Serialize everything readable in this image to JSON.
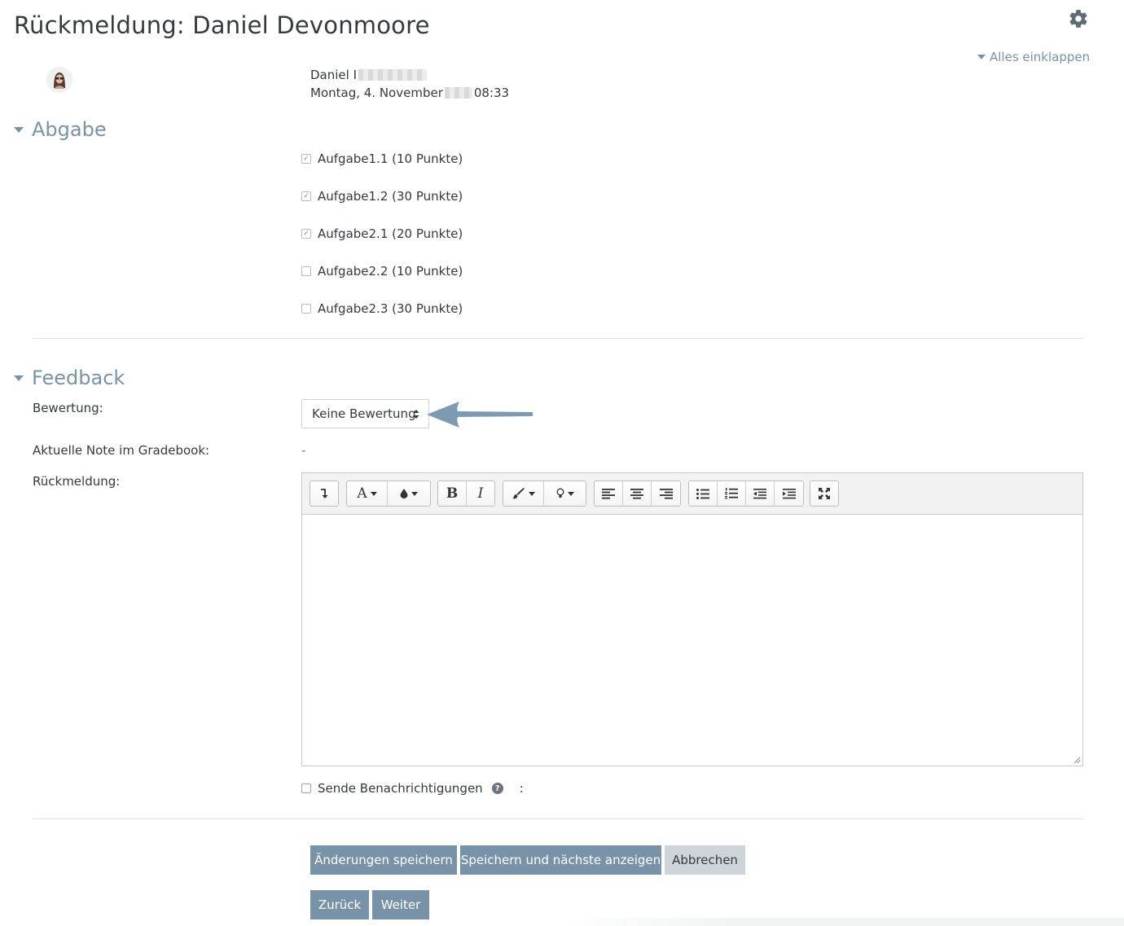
{
  "header": {
    "title": "Rückmeldung: Daniel Devonmoore",
    "collapse_all": "Alles einklappen"
  },
  "user": {
    "name_visible": "Daniel I",
    "date_before": "Montag, 4. November",
    "date_after": " 08:33"
  },
  "submission": {
    "heading": "Abgabe",
    "items": [
      {
        "label": "Aufgabe1.1 (10 Punkte)",
        "checked": true
      },
      {
        "label": "Aufgabe1.2 (30 Punkte)",
        "checked": true
      },
      {
        "label": "Aufgabe2.1 (20 Punkte)",
        "checked": true
      },
      {
        "label": "Aufgabe2.2 (10 Punkte)",
        "checked": false
      },
      {
        "label": "Aufgabe2.3 (30 Punkte)",
        "checked": false
      }
    ]
  },
  "feedback": {
    "heading": "Feedback",
    "grade_label": "Bewertung:",
    "grade_value": "Keine Bewertung",
    "current_grade_label": "Aktuelle Note im Gradebook:",
    "current_grade_value": "-",
    "comment_label": "Rückmeldung:",
    "editor_text": "",
    "toolbar": {
      "bold": "B",
      "italic": "I",
      "font": "A"
    },
    "notify_label": "Sende Benachrichtigungen",
    "notify_help": "?",
    "notify_colon": ":"
  },
  "buttons": {
    "save": "Änderungen speichern",
    "save_next": "Speichern und nächste anzeigen",
    "cancel": "Abbrechen",
    "previous": "Zurück",
    "next": "Weiter"
  },
  "colors": {
    "accent": "#7893a8",
    "secondary_button": "#ced4da",
    "text": "#343a40"
  }
}
